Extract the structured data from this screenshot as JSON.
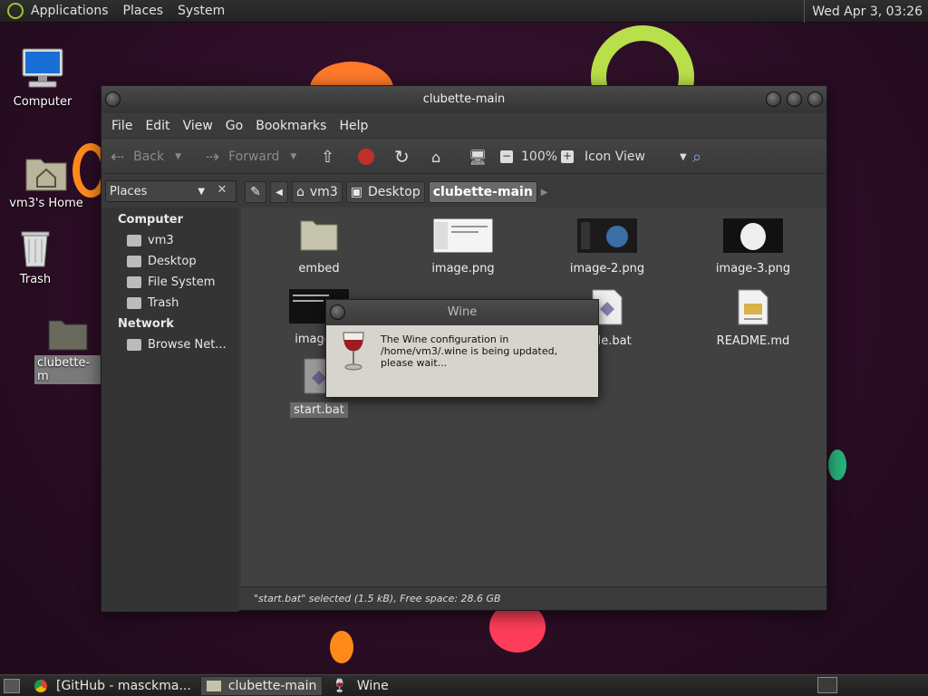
{
  "panel": {
    "menus": [
      "Applications",
      "Places",
      "System"
    ],
    "clock": "Wed Apr  3, 03:26"
  },
  "desktop": {
    "icons": [
      {
        "label": "Computer"
      },
      {
        "label": "vm3's Home"
      },
      {
        "label": "Trash"
      },
      {
        "label": "clubette-m"
      }
    ]
  },
  "window": {
    "title": "clubette-main",
    "menubar": [
      "File",
      "Edit",
      "View",
      "Go",
      "Bookmarks",
      "Help"
    ],
    "toolbar": {
      "back": "Back",
      "forward": "Forward",
      "zoom": "100%",
      "view_mode": "Icon View"
    },
    "sidebar": {
      "selector": "Places",
      "computer_head": "Computer",
      "computer_items": [
        "vm3",
        "Desktop",
        "File System",
        "Trash"
      ],
      "network_head": "Network",
      "network_items": [
        "Browse Net..."
      ]
    },
    "breadcrumbs": [
      "vm3",
      "Desktop",
      "clubette-main"
    ],
    "files": [
      {
        "name": "embed",
        "type": "folder"
      },
      {
        "name": "image.png",
        "type": "image"
      },
      {
        "name": "image-2.png",
        "type": "image"
      },
      {
        "name": "image-3.png",
        "type": "image"
      },
      {
        "name": "image-4",
        "type": "image"
      },
      {
        "name": "nfile.bat",
        "type": "bat"
      },
      {
        "name": "README.md",
        "type": "text"
      },
      {
        "name": "start.bat",
        "type": "bat"
      }
    ],
    "status": "\"start.bat\" selected (1.5 kB), Free space: 28.6 GB"
  },
  "wine_dialog": {
    "title": "Wine",
    "message": "The Wine configuration in /home/vm3/.wine is being updated, please wait..."
  },
  "taskbar": {
    "tasks": [
      "[GitHub - masckma...",
      "clubette-main",
      "Wine"
    ]
  }
}
